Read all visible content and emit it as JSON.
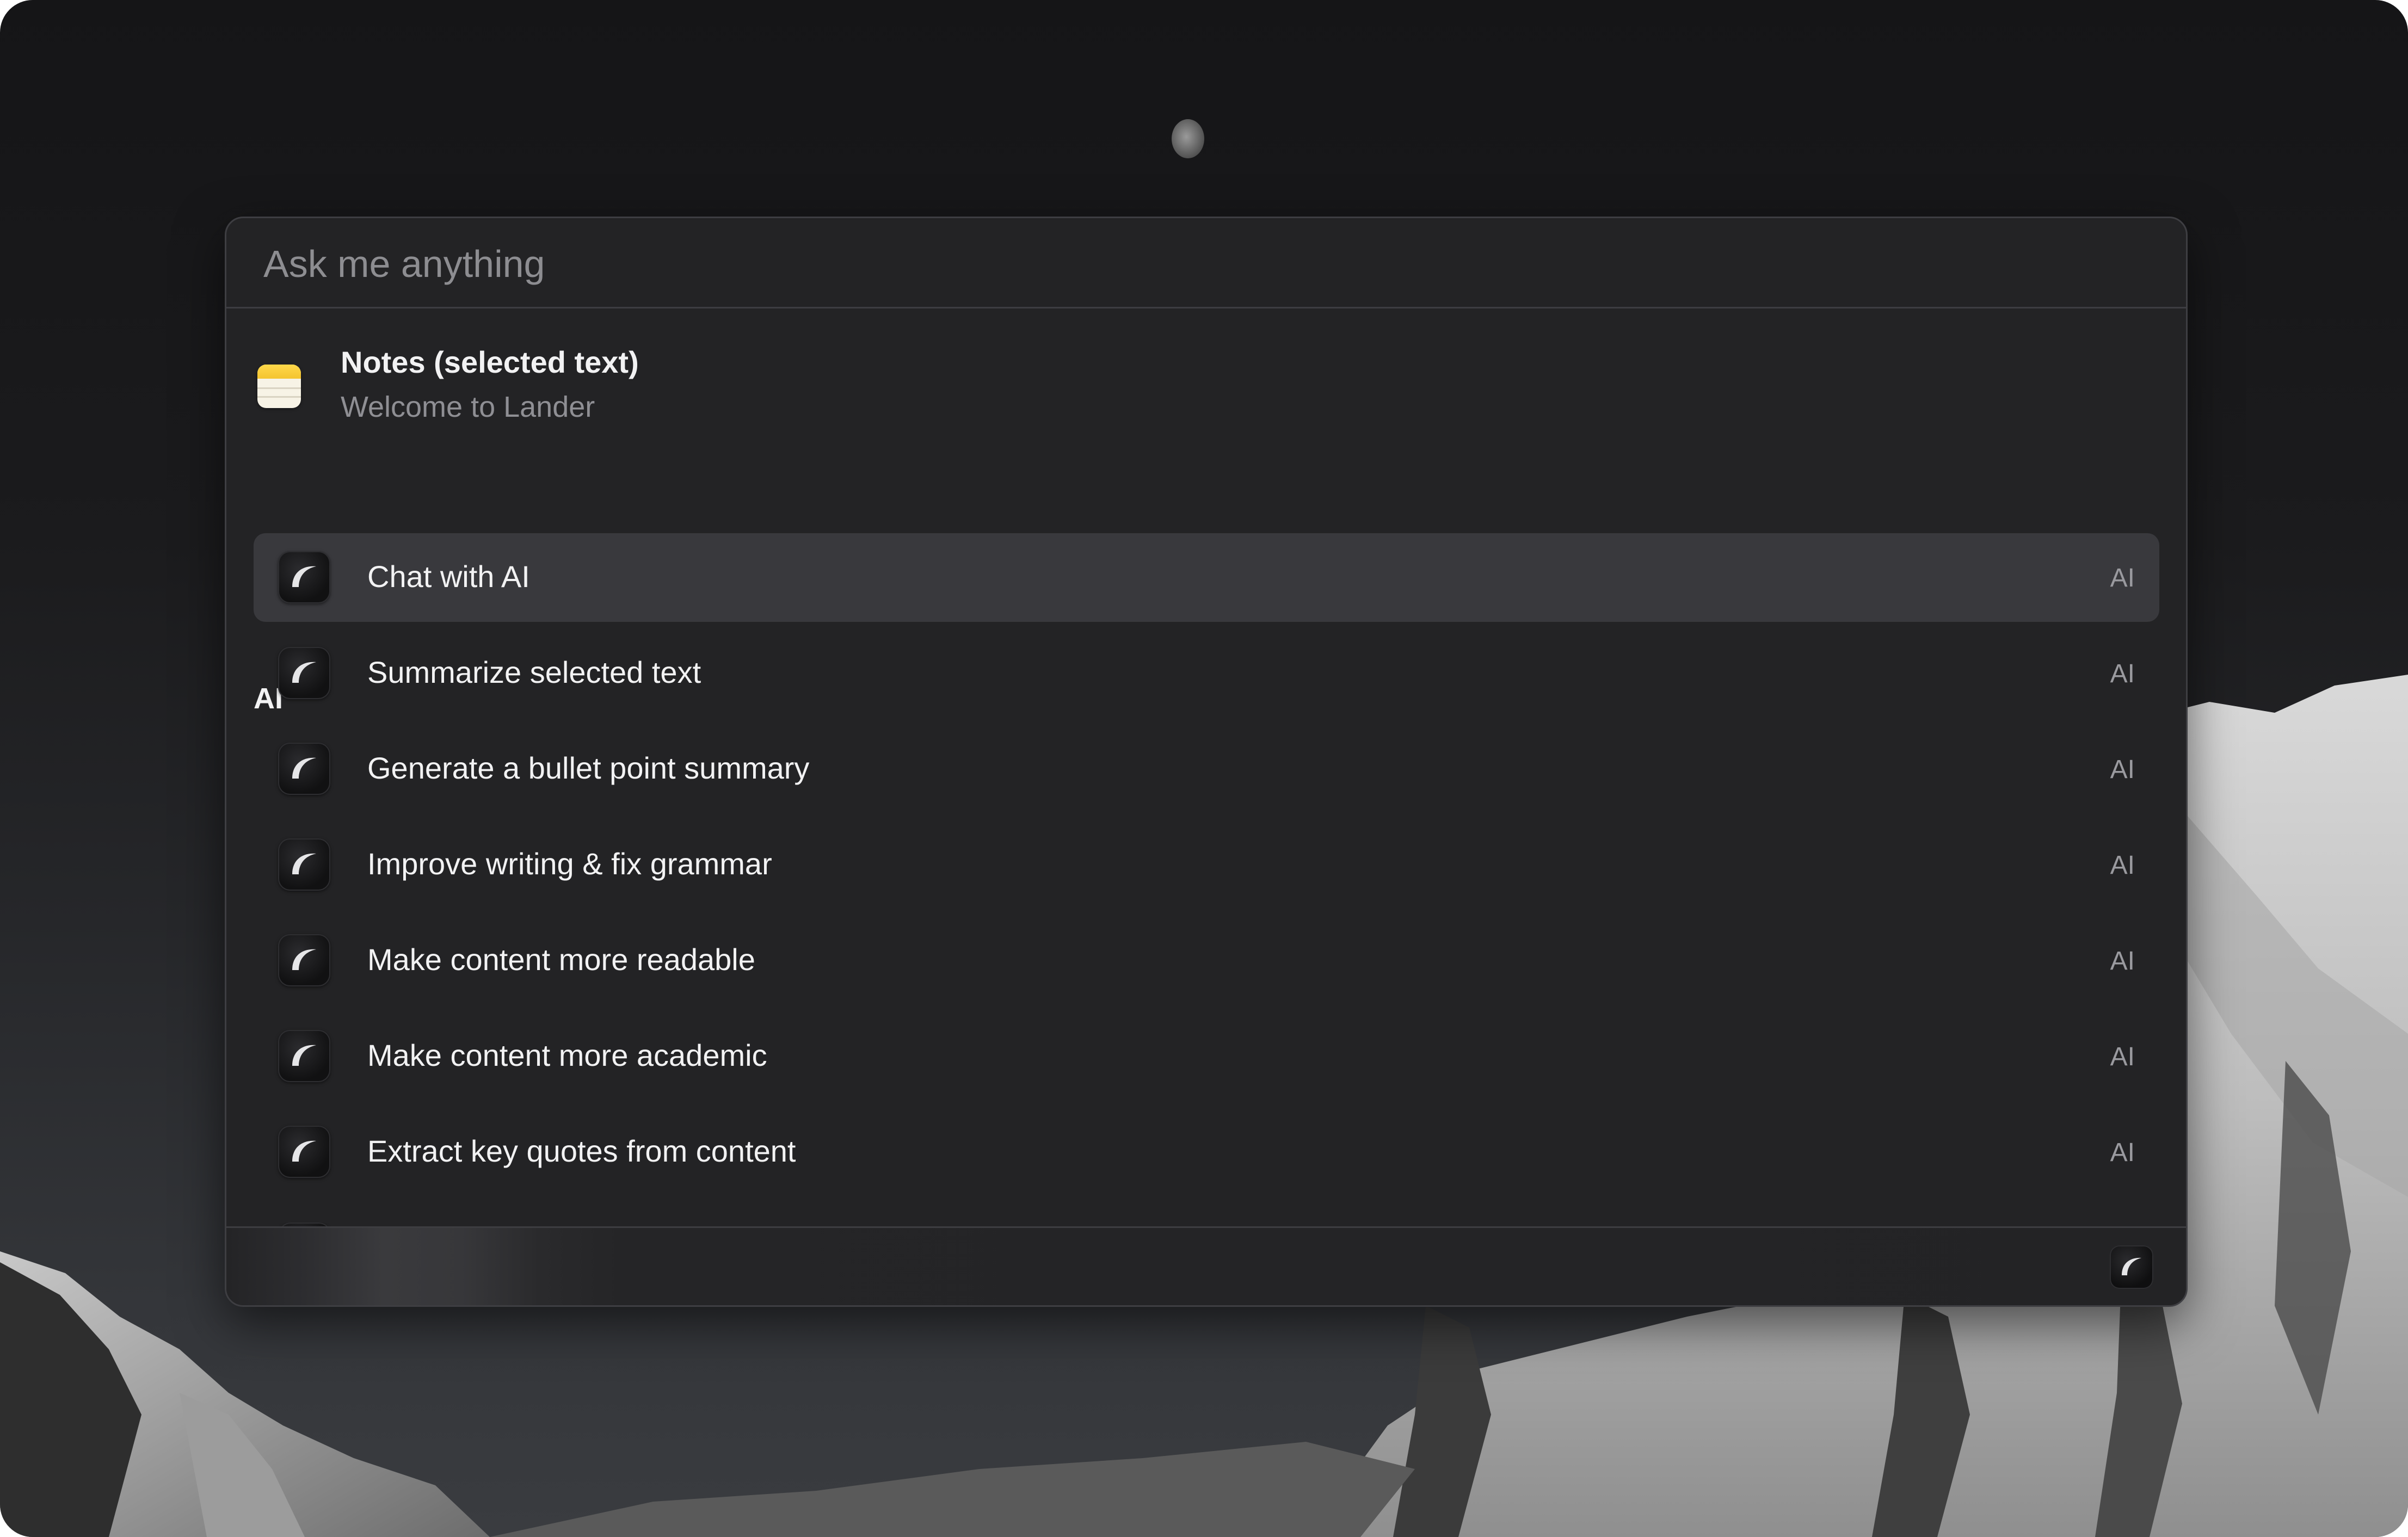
{
  "search": {
    "placeholder": "Ask me anything"
  },
  "context": {
    "title": "Notes (selected text)",
    "subtitle": "Welcome to Lander",
    "icon": "notes-app-icon"
  },
  "section": {
    "title": "AI"
  },
  "items": [
    {
      "label": "Chat with AI",
      "tag": "AI",
      "icon": "lander-ai-icon",
      "selected": true
    },
    {
      "label": "Summarize selected text",
      "tag": "AI",
      "icon": "lander-ai-icon",
      "selected": false
    },
    {
      "label": "Generate a bullet point summary",
      "tag": "AI",
      "icon": "lander-ai-icon",
      "selected": false
    },
    {
      "label": "Improve writing & fix grammar",
      "tag": "AI",
      "icon": "lander-ai-icon",
      "selected": false
    },
    {
      "label": "Make content more readable",
      "tag": "AI",
      "icon": "lander-ai-icon",
      "selected": false
    },
    {
      "label": "Make content more academic",
      "tag": "AI",
      "icon": "lander-ai-icon",
      "selected": false
    },
    {
      "label": "Extract key quotes from content",
      "tag": "AI",
      "icon": "lander-ai-icon",
      "selected": false
    }
  ],
  "footer": {
    "icon": "lander-ai-icon"
  },
  "colors": {
    "window_bg": "#232325",
    "selected_row": "#39393d",
    "notes_yellow": "#f4c430"
  }
}
